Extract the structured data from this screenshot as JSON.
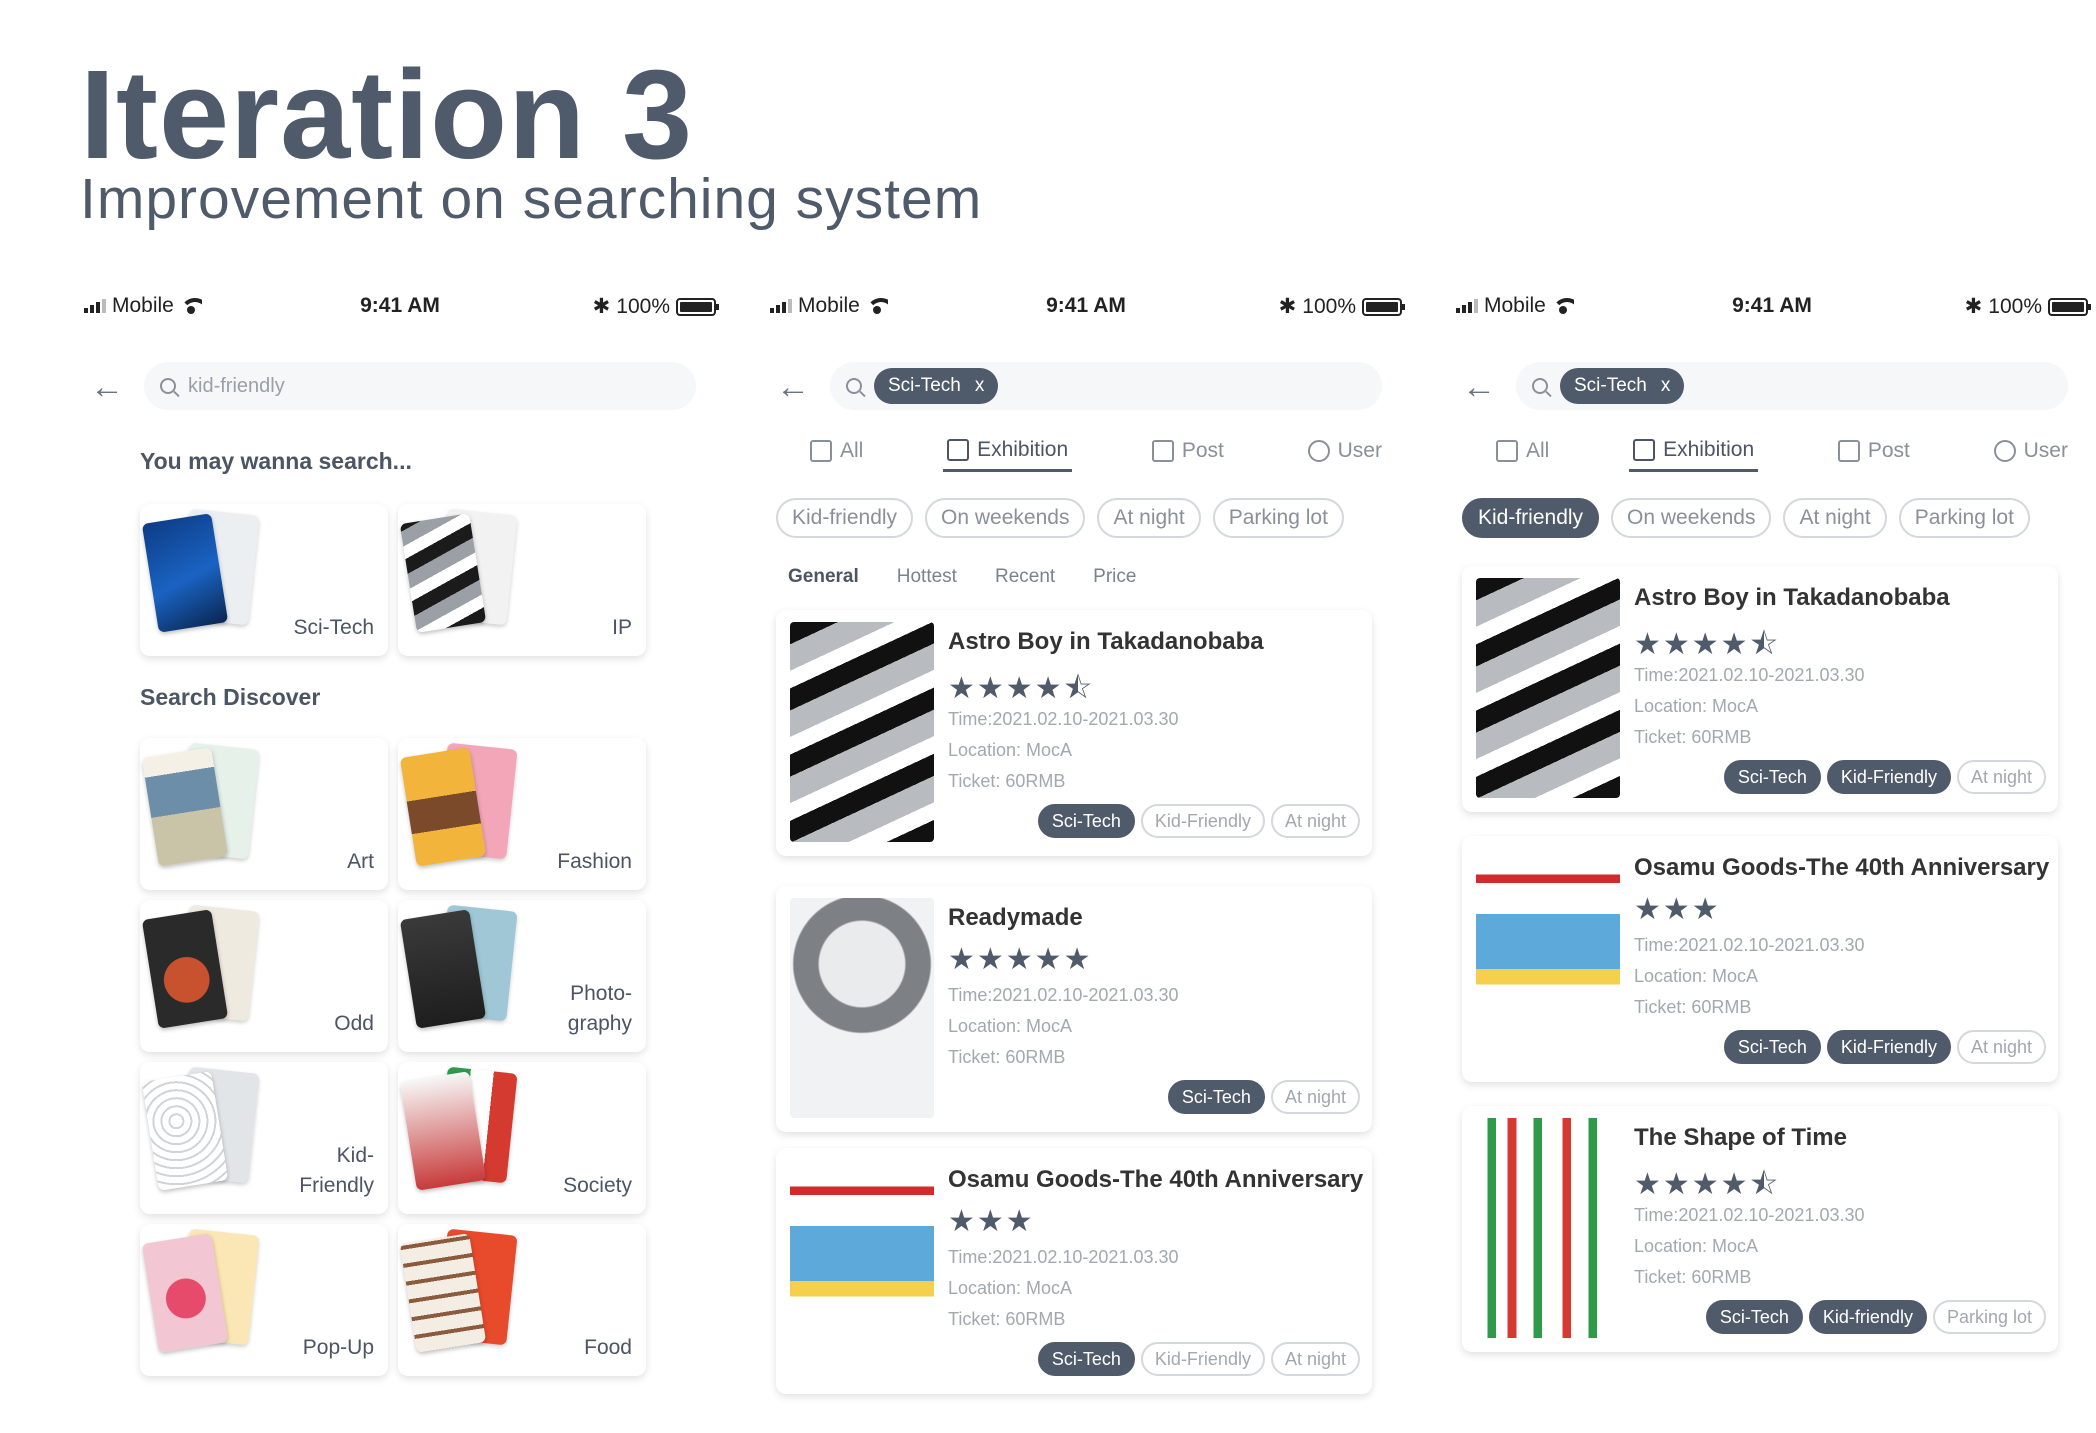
{
  "header": {
    "title": "Iteration 3",
    "subtitle": "Improvement on searching system"
  },
  "status": {
    "carrier": "Mobile",
    "time": "9:41 AM",
    "battery": "100%"
  },
  "screen1": {
    "search_placeholder": "kid-friendly",
    "suggest_title": "You may wanna search...",
    "suggest": [
      {
        "label": "Sci-Tech"
      },
      {
        "label": "IP"
      }
    ],
    "discover_title": "Search Discover",
    "discover": [
      {
        "label": "Art"
      },
      {
        "label": "Fashion"
      },
      {
        "label": "Odd"
      },
      {
        "label": "Photo-\ngraphy"
      },
      {
        "label": "Kid-\nFriendly"
      },
      {
        "label": "Society"
      },
      {
        "label": "Pop-Up"
      },
      {
        "label": "Food"
      }
    ]
  },
  "screen2": {
    "query_chip": "Sci-Tech",
    "chip_close": "x",
    "tabs": [
      "All",
      "Exhibition",
      "Post",
      "User"
    ],
    "filters": [
      "Kid-friendly",
      "On weekends",
      "At night",
      "Parking lot"
    ],
    "sorts": [
      "General",
      "Hottest",
      "Recent",
      "Price"
    ],
    "results": [
      {
        "title": "Astro Boy in Takadanobaba",
        "stars": "★★★★⯪",
        "time": "Time:2021.02.10-2021.03.30",
        "location": "Location: MocA",
        "ticket": "Ticket: 60RMB",
        "tags": [
          "Sci-Tech",
          "Kid-Friendly",
          "At night"
        ]
      },
      {
        "title": "Readymade",
        "stars": "★★★★★",
        "time": "Time:2021.02.10-2021.03.30",
        "location": "Location: MocA",
        "ticket": "Ticket: 60RMB",
        "tags": [
          "Sci-Tech",
          "At night"
        ]
      },
      {
        "title": "Osamu Goods-The 40th Anniversary",
        "stars": "★★★",
        "time": "Time:2021.02.10-2021.03.30",
        "location": "Location: MocA",
        "ticket": "Ticket: 60RMB",
        "tags": [
          "Sci-Tech",
          "Kid-Friendly",
          "At night"
        ]
      }
    ]
  },
  "screen3": {
    "query_chip": "Sci-Tech",
    "chip_close": "x",
    "tabs": [
      "All",
      "Exhibition",
      "Post",
      "User"
    ],
    "filters": [
      "Kid-friendly",
      "On weekends",
      "At night",
      "Parking lot"
    ],
    "results": [
      {
        "title": "Astro Boy in Takadanobaba",
        "stars": "★★★★⯪",
        "time": "Time:2021.02.10-2021.03.30",
        "location": "Location: MocA",
        "ticket": "Ticket: 60RMB",
        "tags": [
          "Sci-Tech",
          "Kid-Friendly",
          "At night"
        ]
      },
      {
        "title": "Osamu Goods-The 40th Anniversary",
        "stars": "★★★",
        "time": "Time:2021.02.10-2021.03.30",
        "location": "Location: MocA",
        "ticket": "Ticket: 60RMB",
        "tags": [
          "Sci-Tech",
          "Kid-Friendly",
          "At night"
        ]
      },
      {
        "title": "The Shape of Time",
        "stars": "★★★★⯪",
        "time": "Time:2021.02.10-2021.03.30",
        "location": "Location: MocA",
        "ticket": "Ticket: 60RMB",
        "tags": [
          "Sci-Tech",
          "Kid-friendly",
          "Parking lot"
        ]
      }
    ]
  },
  "colors": {
    "accent": "#4f5a6a",
    "muted": "#a3a8af",
    "chip_border": "#d4d7db"
  }
}
